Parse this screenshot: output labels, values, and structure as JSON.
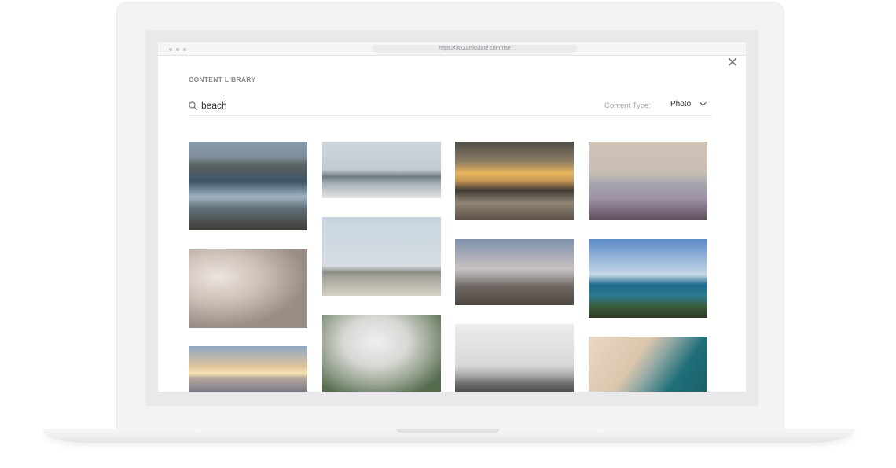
{
  "browser": {
    "url": "https://360.articulate.com/rise"
  },
  "library": {
    "title": "CONTENT LIBRARY",
    "search_value": "beach",
    "content_type_label": "Content Type:",
    "content_type_value": "Photo",
    "close_icon": "close-icon",
    "search_icon": "search-icon",
    "chevron_icon": "chevron-down-icon"
  },
  "photos": [
    "beach-photo-rocky-coast",
    "beach-photo-foggy-pier",
    "beach-photo-golden-sunset",
    "beach-photo-hazy-shore",
    "beach-photo-misty-rocks",
    "beach-photo-crowded-shoreline",
    "beach-photo-dusk-sand",
    "beach-photo-green-hill-coast",
    "beach-photo-sunrise-horizon",
    "beach-photo-aerial-fog-town",
    "beach-photo-gray-sea-figure",
    "beach-photo-aerial-sand-water"
  ]
}
